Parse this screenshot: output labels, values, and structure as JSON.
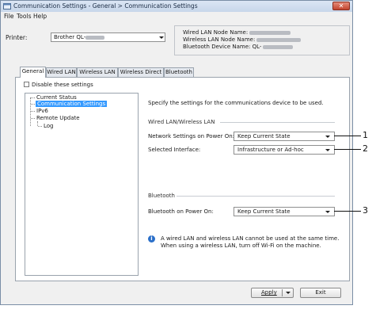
{
  "window": {
    "title": "Communication Settings - General > Communication Settings",
    "close_glyph": "✕"
  },
  "menu": [
    "File",
    "Tools",
    "Help"
  ],
  "printer": {
    "label": "Printer:",
    "value": "Brother QL-"
  },
  "info": {
    "wired_lan": "Wired LAN Node Name:",
    "wireless_lan": "Wireless LAN Node Name:",
    "bluetooth": "Bluetooth Device Name: QL-"
  },
  "tabs": [
    "General",
    "Wired LAN",
    "Wireless LAN",
    "Wireless Direct",
    "Bluetooth"
  ],
  "active_tab": 0,
  "disable_settings": {
    "label": "Disable these settings",
    "checked": false
  },
  "tree": {
    "items": [
      "Current Status",
      "Communication Settings",
      "IPv6",
      "Remote Update",
      "Log"
    ],
    "selected": 1
  },
  "description": "Specify the settings for the communications device to be used.",
  "wired_wireless": {
    "section_label": "Wired LAN/Wireless LAN",
    "network_on_power_label": "Network Settings on Power On:",
    "network_on_power_value": "Keep Current State",
    "interface_label": "Selected Interface:",
    "interface_value": "Infrastructure or Ad-hoc"
  },
  "bluetooth": {
    "section_label": "Bluetooth",
    "on_power_label": "Bluetooth on Power On:",
    "on_power_value": "Keep Current State"
  },
  "note": {
    "line1": "A wired LAN and wireless LAN cannot be used at the same time.",
    "line2": "When using a wireless LAN, turn off Wi-Fi on the machine."
  },
  "callouts": [
    "1",
    "2",
    "3"
  ],
  "buttons": {
    "apply": "Apply",
    "exit": "Exit"
  },
  "icons": {
    "app": "window-icon",
    "info": "info-icon",
    "dropdown": "chevron-down-icon"
  },
  "colors": {
    "selection": "#3399ff",
    "info_icon": "#2a6fc9",
    "close": "#c2452f"
  }
}
